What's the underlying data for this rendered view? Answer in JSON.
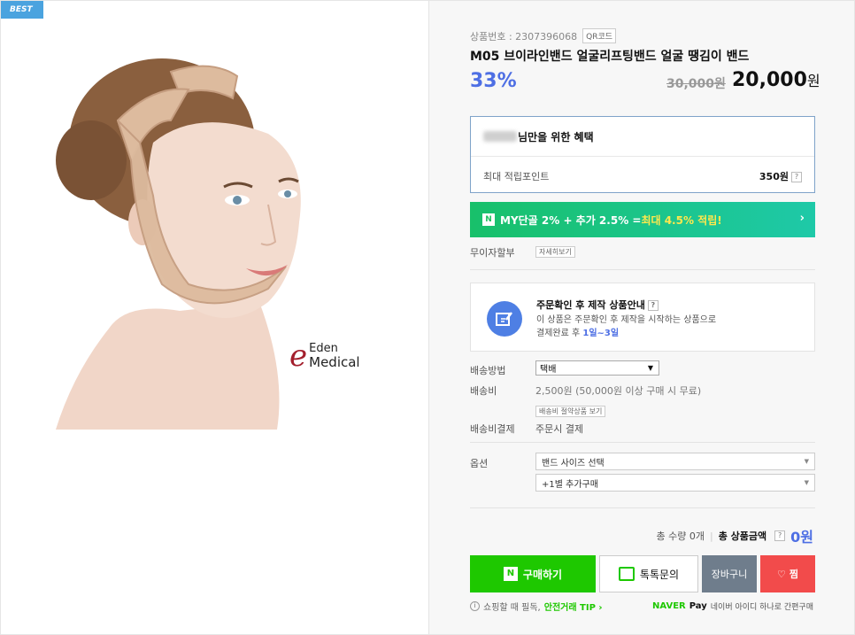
{
  "badge": "BEST",
  "brand_logo": {
    "line1": "Eden",
    "line2": "Medical",
    "mark": "e"
  },
  "product": {
    "number_label": "상품번호 : 2307396068",
    "qr_label": "QR코드",
    "title": "M05 브이라인밴드 얼굴리프팅밴드 얼굴 땡김이 밴드",
    "discount": "33%",
    "original_price": "30,000원",
    "price_value": "20,000",
    "price_unit": "원"
  },
  "benefit": {
    "title_suffix": "님만을 위한 혜택",
    "point_label": "최대 적립포인트",
    "point_value": "350원",
    "help": "?"
  },
  "npay_banner": {
    "badge": "N",
    "text1": "MY단골 2% + 추가 2.5% = ",
    "text2": "최대 4.5% 적립!",
    "arrow": "›"
  },
  "installment": {
    "label": "무이자할부",
    "button": "자세히보기"
  },
  "notice": {
    "title": "주문확인 후 제작 상품안내",
    "line1": "이 상품은 주문확인 후 제작을 시작하는 상품으로",
    "line2_prefix": "결제완료 후 ",
    "line2_highlight": "1일~3일"
  },
  "shipping": {
    "method_label": "배송방법",
    "method_value": "택배",
    "fee_label": "배송비",
    "fee_value": "2,500원 (50,000원 이상 구매 시 무료)",
    "fee_button": "배송비 절약상품 보기",
    "payment_label": "배송비결제",
    "payment_value": "주문시 결제"
  },
  "options": {
    "label": "옵션",
    "select1": "밴드 사이즈 선택",
    "select2": "+1별 추가구매"
  },
  "total": {
    "qty": "총 수량 0개",
    "label": "총 상품금액",
    "amount": "0원"
  },
  "buttons": {
    "buy": "구매하기",
    "talk": "톡톡문의",
    "cart": "장바구니",
    "wish": "찜"
  },
  "footer": {
    "tip_prefix": "쇼핑할 때 필독, ",
    "tip_link": "안전거래 TIP ›",
    "naver": "NAVER",
    "pay": "Pay",
    "naver_text": "네이버 아이디 하나로 간편구매"
  }
}
